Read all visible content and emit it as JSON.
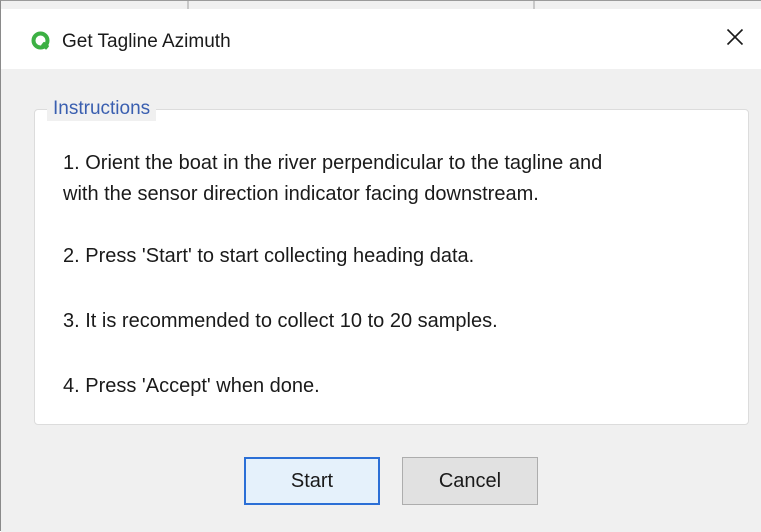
{
  "window": {
    "title": "Get Tagline Azimuth",
    "app_icon": "q-logo-icon",
    "close_icon": "close-icon",
    "accent_color": "#3cb043"
  },
  "instructions": {
    "legend": "Instructions",
    "step1_line1": "1. Orient the boat in the river perpendicular to the tagline and",
    "step1_line2": "with the sensor direction indicator facing downstream.",
    "step2": "2. Press 'Start' to start collecting heading data.",
    "step3": "3. It is recommended to collect 10 to 20 samples.",
    "step4": "4. Press 'Accept' when done."
  },
  "buttons": {
    "start_label": "Start",
    "cancel_label": "Cancel"
  }
}
